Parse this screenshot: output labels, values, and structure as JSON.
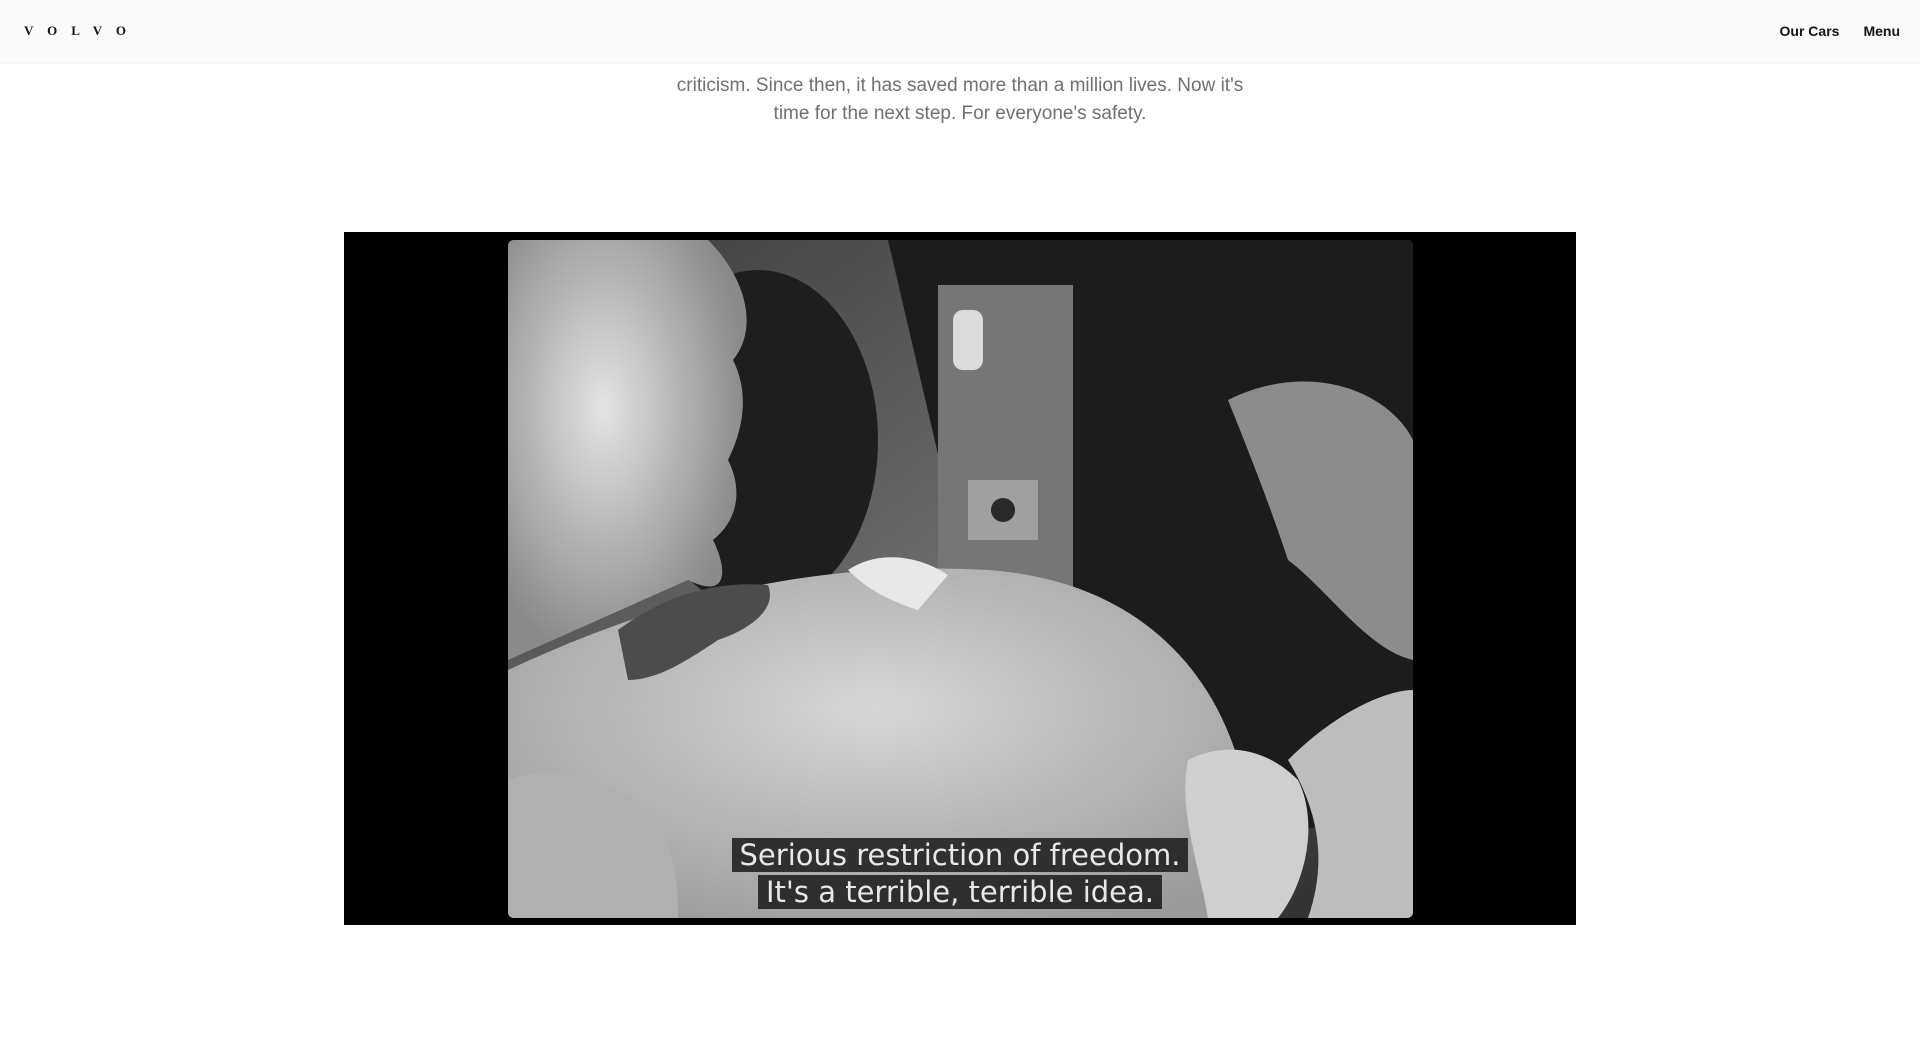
{
  "header": {
    "logo_text": "VOLVO",
    "nav": {
      "our_cars": "Our Cars",
      "menu": "Menu"
    }
  },
  "intro": {
    "line_1": "criticism. Since then, it has saved more than a million lives. Now it's",
    "line_2": "time for the next step. For everyone's safety."
  },
  "video": {
    "caption_line_1": "Serious restriction of freedom.",
    "caption_line_2": "It's a terrible, terrible idea."
  },
  "colors": {
    "header_bg": "#fafafa",
    "text_primary": "#141414",
    "text_muted": "#707070",
    "video_bg": "#000000"
  }
}
